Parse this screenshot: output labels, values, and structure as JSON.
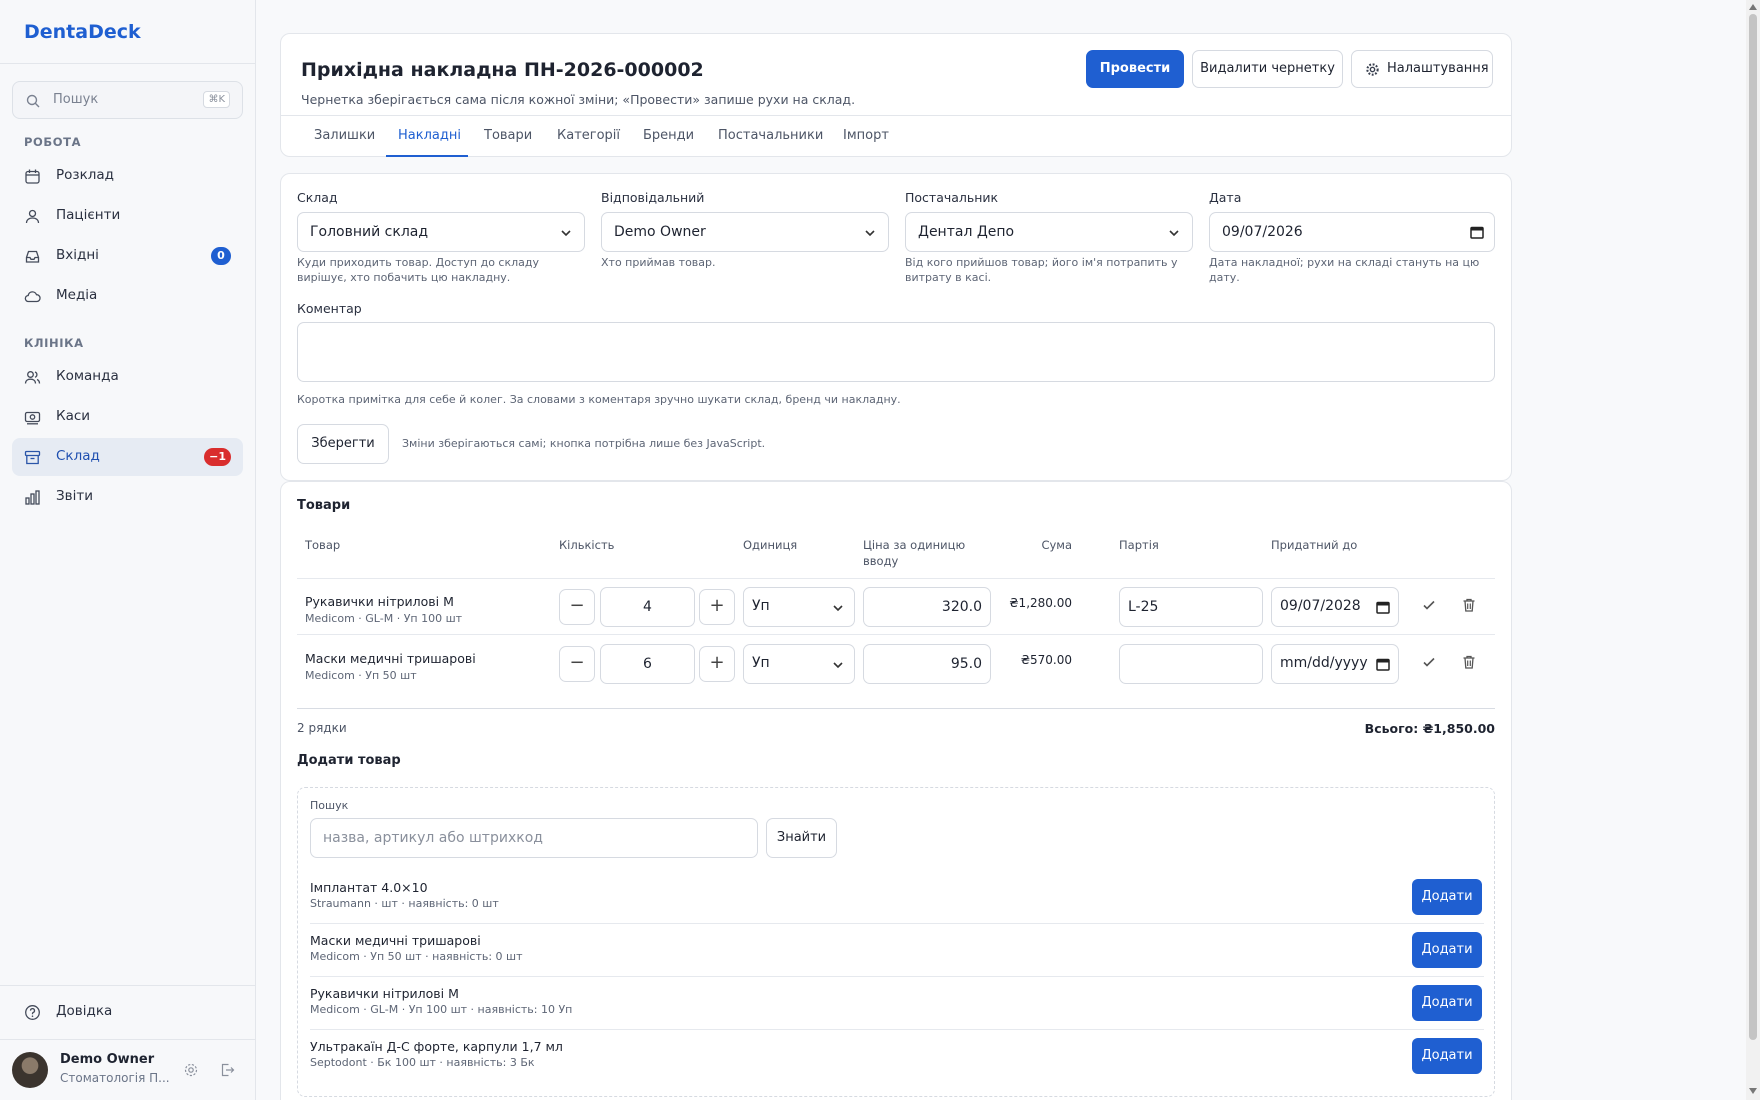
{
  "app": {
    "brand": "DentaDeck"
  },
  "sidebar": {
    "search_placeholder": "Пошук",
    "search_shortcut": "⌘K",
    "sections": [
      {
        "label": "РОБОТА"
      },
      {
        "label": "КЛІНІКА"
      }
    ],
    "items": [
      {
        "label": "Розклад",
        "icon": "calendar-icon"
      },
      {
        "label": "Пацієнти",
        "icon": "users-icon"
      },
      {
        "label": "Вхідні",
        "icon": "inbox-icon",
        "badge": "0"
      },
      {
        "label": "Медіа",
        "icon": "cloud-icon"
      },
      {
        "label": "Команда",
        "icon": "team-icon"
      },
      {
        "label": "Каси",
        "icon": "cash-icon"
      },
      {
        "label": "Склад",
        "icon": "archive-icon",
        "badge": "−1",
        "active": true
      },
      {
        "label": "Звіти",
        "icon": "chart-icon"
      }
    ],
    "help": "Довідка",
    "user": {
      "name": "Demo Owner",
      "org": "Стоматологія П..."
    }
  },
  "header": {
    "title": "Прихідна накладна ПН-2026-000002",
    "subtitle": "Чернетка зберігається сама після кожної зміни; «Провести» запише рухи на склад.",
    "post_label": "Провести",
    "delete_draft_label": "Видалити чернетку",
    "settings_label": "Налаштування",
    "tabs": [
      "Залишки",
      "Накладні",
      "Товари",
      "Категорії",
      "Бренди",
      "Постачальники",
      "Імпорт"
    ],
    "active_tab": "Накладні"
  },
  "form": {
    "warehouse": {
      "label": "Склад",
      "value": "Головний склад",
      "hint": "Куди приходить товар. Доступ до складу вирішує, хто побачить цю накладну."
    },
    "responsible": {
      "label": "Відповідальний",
      "value": "Demo Owner",
      "hint": "Хто приймав товар."
    },
    "supplier": {
      "label": "Постачальник",
      "value": "Дентал Депо",
      "hint": "Від кого прийшов товар; його ім'я потрапить у витрату в касі."
    },
    "date": {
      "label": "Дата",
      "value": "09/07/2026",
      "hint": "Дата накладної; рухи на складі стануть на цю дату."
    },
    "comment": {
      "label": "Коментар",
      "value": "",
      "hint": "Коротка примітка для себе й колег. За словами з коментаря зручно шукати склад, бренд чи накладну."
    },
    "save_label": "Зберегти",
    "save_hint": "Зміни зберігаються самі; кнопка потрібна лише без JavaScript."
  },
  "items": {
    "title": "Товари",
    "columns": {
      "product": "Товар",
      "qty": "Кількість",
      "unit": "Одиниця",
      "price_line1": "Ціна за одиницю",
      "price_line2": "вводу",
      "sum": "Сума",
      "batch": "Партія",
      "expiry": "Придатний до"
    },
    "rows": [
      {
        "name": "Рукавички нітрилові M",
        "sub": "Medicom · GL-M · Уп 100 шт",
        "qty": "4",
        "unit": "Уп",
        "price": "320.0",
        "sum": "₴1,280.00",
        "batch": "L-25",
        "expiry": "09/07/2028"
      },
      {
        "name": "Маски медичні тришарові",
        "sub": "Medicom · Уп 50 шт",
        "qty": "6",
        "unit": "Уп",
        "price": "95.0",
        "sum": "₴570.00",
        "batch": "",
        "expiry": "mm/dd/yyyy"
      }
    ],
    "rows_count": "2 рядки",
    "total": "Всього: ₴1,850.00"
  },
  "add": {
    "title": "Додати товар",
    "search_label": "Пошук",
    "search_placeholder": "назва, артикул або штрихкод",
    "find_label": "Знайти",
    "add_label": "Додати",
    "results": [
      {
        "name": "Імплантат 4.0×10",
        "sub": "Straumann · шт · наявність: 0 шт"
      },
      {
        "name": "Маски медичні тришарові",
        "sub": "Medicom · Уп 50 шт · наявність: 0 шт"
      },
      {
        "name": "Рукавички нітрилові M",
        "sub": "Medicom · GL-M · Уп 100 шт · наявність: 10 Уп"
      },
      {
        "name": "Ультракаїн Д-С форте, карпули 1,7 мл",
        "sub": "Septodont · Бк 100 шт · наявність: 3 Бк"
      }
    ]
  },
  "colors": {
    "accent": "#1f5fd1",
    "danger": "#d92d2d"
  }
}
